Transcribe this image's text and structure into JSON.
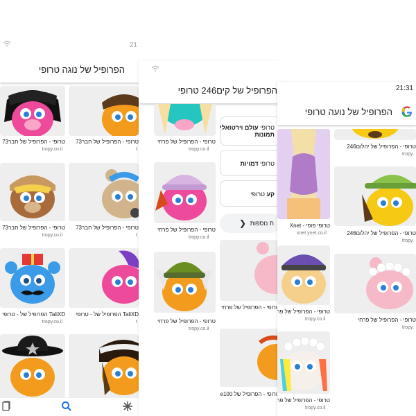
{
  "panel1": {
    "status_time": "21",
    "search_query": "הפרופיל של נוגה טרופי",
    "rows": [
      {
        "left": {
          "caption": "טרופי - הפרופיל של חבר73",
          "source": "tropy.co.il"
        },
        "right": {
          "caption": "טרופי - הפרופיל של חבר73",
          "source": "t"
        }
      },
      {
        "left": {
          "caption": "טרופי - הפרופיל של חבר73",
          "source": "tropy.co.il"
        },
        "right": {
          "caption": "טרופי - הפרופיל של חבר73",
          "source": "t"
        }
      },
      {
        "left": {
          "caption": "TaliXD הפרופיל של - טרופי",
          "source": "tropy.co.il"
        },
        "right": {
          "caption": "TaliXD הפרופיל של - טרופי",
          "source": "t"
        }
      }
    ],
    "nav": {
      "collections_icon": "collections-icon",
      "search_icon": "search-icon",
      "discover_icon": "asterisk-icon"
    }
  },
  "panel2": {
    "search_query": "הפרופיל של קים246 טרופי",
    "images": [
      {
        "caption": "טרופי - הפרופיל של פרחי",
        "source": "tropy.co.il"
      },
      {
        "caption": "טרופי - הפרופיל של פרחי",
        "source": "tropy.co.il"
      },
      {
        "caption": "טרופי - הפרופיל של פרחי",
        "source": "tropy.co.il"
      },
      {
        "caption": "טרופי - הפרופיל של פרחי",
        "source": "tropy.co.il"
      },
      {
        "caption": "טרופי - הפרופיל של maple100",
        "source": ""
      }
    ],
    "related": [
      {
        "prefix": "טרופי",
        "bold": "עולם וירטואלי",
        "line2": "תמונות"
      },
      {
        "prefix": "טרופי",
        "bold": "דמויות",
        "line2": ""
      },
      {
        "prefix": "",
        "bold": "קע",
        "line2": "טרופי"
      }
    ],
    "more_label": "ת נוספות"
  },
  "panel3": {
    "status_time": "21:31",
    "search_query": "הפרופיל של נועה טרופי",
    "left_images": [
      {
        "caption": "טרופי פופי - Xnet",
        "source": "xnet.ynet.co.il"
      },
      {
        "caption": "טרופי - הפרופיל של פרחי",
        "source": "tropy.co.il"
      },
      {
        "caption": "טרופי - הפרופיל של פרחי",
        "source": "tropy.co.il"
      }
    ],
    "right_images": [
      {
        "caption": "טרופי - הפרופיל של יהלום246",
        "source": "tropy."
      },
      {
        "caption": "טרופי - הפרופיל של יהלום246",
        "source": "tropy."
      },
      {
        "caption": "טרופי - הפרופיל של פרחי",
        "source": "tropy."
      }
    ]
  },
  "colors": {
    "pink": "#ee4a9c",
    "orange": "#f29b1c",
    "blue": "#3b9be8",
    "brown": "#a86b3c",
    "tan": "#d2b48c",
    "teal": "#26c6c0",
    "yellow": "#f6c915",
    "lightpink": "#f6b9c8"
  }
}
